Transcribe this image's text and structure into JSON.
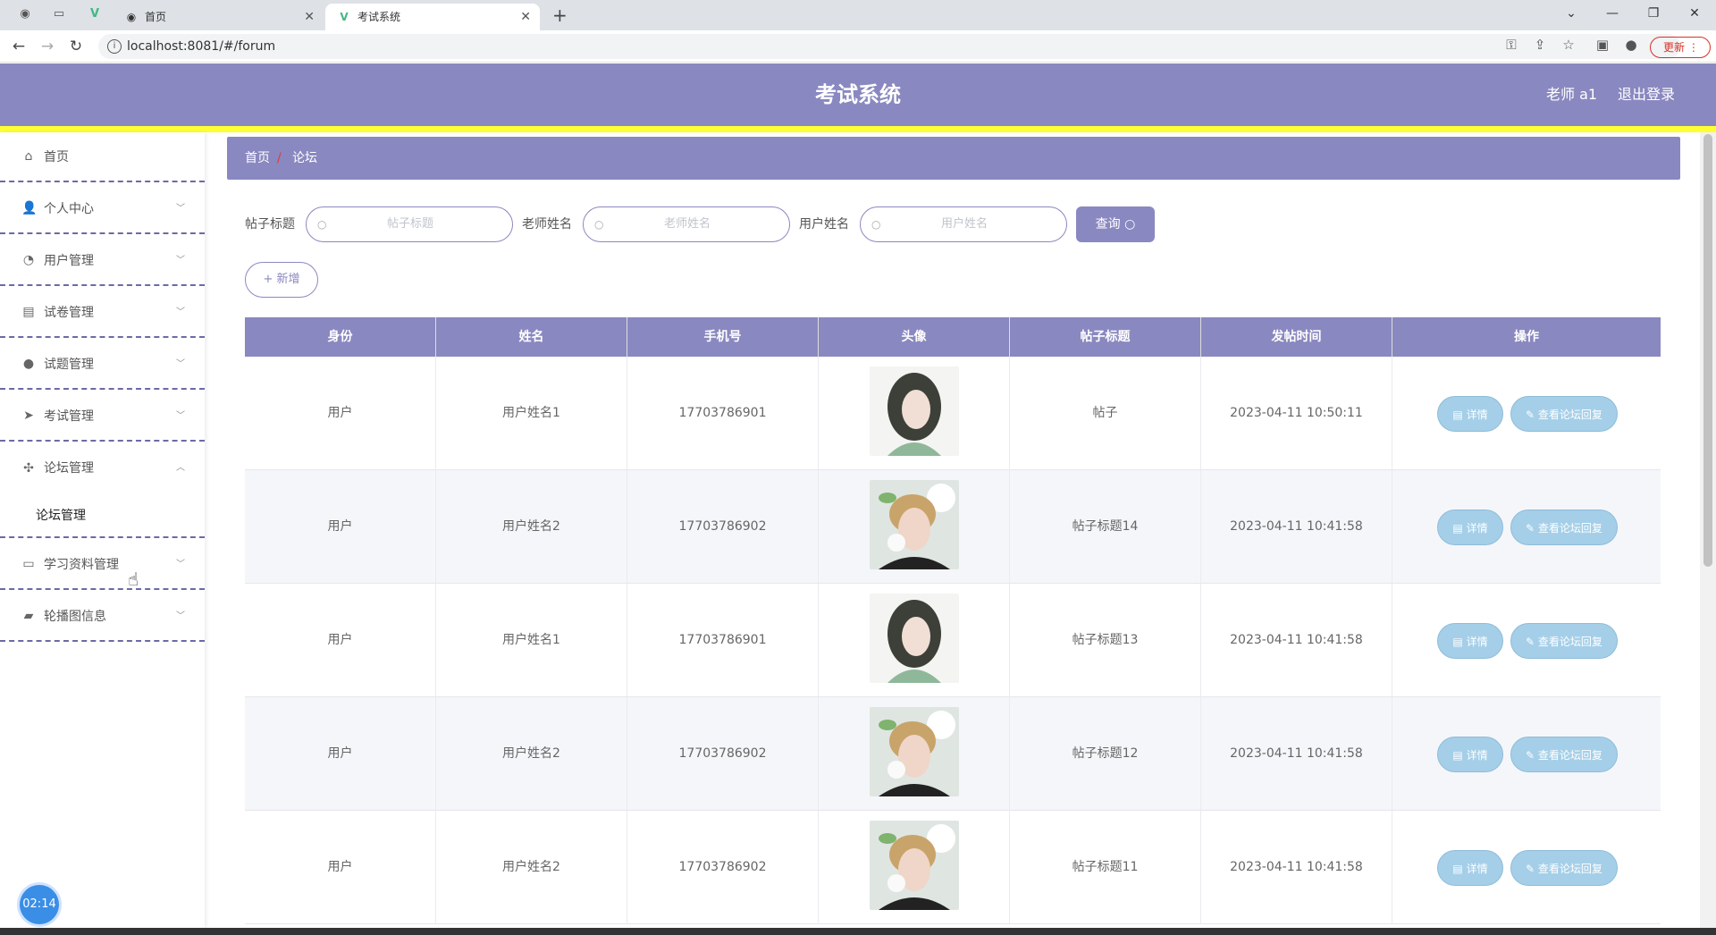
{
  "browser": {
    "tabs": [
      {
        "label": "",
        "icon": "globe-icon"
      },
      {
        "label": "",
        "icon": "page-icon"
      },
      {
        "label": "",
        "icon": "vue-icon"
      },
      {
        "label": "首页",
        "icon": "globe-icon"
      },
      {
        "label": "考试系统",
        "icon": "vue-icon"
      }
    ],
    "url": "localhost:8081/#/forum",
    "update_label": "更新"
  },
  "header": {
    "title": "考试系统",
    "user": "老师 a1",
    "logout": "退出登录"
  },
  "sidebar": {
    "items": [
      {
        "label": "首页",
        "icon": "home-icon",
        "chevron": ""
      },
      {
        "label": "个人中心",
        "icon": "user-icon",
        "chevron": "﹀"
      },
      {
        "label": "用户管理",
        "icon": "gauge-icon",
        "chevron": "﹀"
      },
      {
        "label": "试卷管理",
        "icon": "card-icon",
        "chevron": "﹀"
      },
      {
        "label": "试题管理",
        "icon": "bulb-icon",
        "chevron": "﹀"
      },
      {
        "label": "考试管理",
        "icon": "send-icon",
        "chevron": "﹀"
      },
      {
        "label": "论坛管理",
        "icon": "compass-icon",
        "chevron": "︿"
      },
      {
        "label": "学习资料管理",
        "icon": "chat-icon",
        "chevron": "﹀"
      },
      {
        "label": "轮播图信息",
        "icon": "briefcase-icon",
        "chevron": "﹀"
      }
    ],
    "submenu_label": "论坛管理",
    "timer": "02:14"
  },
  "breadcrumb": {
    "home": "首页",
    "separator": "/",
    "current": "论坛"
  },
  "search": {
    "title_label": "帖子标题",
    "title_placeholder": "帖子标题",
    "teacher_label": "老师姓名",
    "teacher_placeholder": "老师姓名",
    "user_label": "用户姓名",
    "user_placeholder": "用户姓名",
    "query_label": "查询"
  },
  "add_label": "新增",
  "table": {
    "headers": [
      "身份",
      "姓名",
      "手机号",
      "头像",
      "帖子标题",
      "发帖时间",
      "操作"
    ],
    "detail_label": "详情",
    "reply_label": "查看论坛回复",
    "rows": [
      {
        "role": "用户",
        "name": "用户姓名1",
        "phone": "17703786901",
        "avatar": "avatar-a",
        "title": "帖子",
        "time": "2023-04-11 10:50:11"
      },
      {
        "role": "用户",
        "name": "用户姓名2",
        "phone": "17703786902",
        "avatar": "avatar-b",
        "title": "帖子标题14",
        "time": "2023-04-11 10:41:58"
      },
      {
        "role": "用户",
        "name": "用户姓名1",
        "phone": "17703786901",
        "avatar": "avatar-a",
        "title": "帖子标题13",
        "time": "2023-04-11 10:41:58"
      },
      {
        "role": "用户",
        "name": "用户姓名2",
        "phone": "17703786902",
        "avatar": "avatar-b",
        "title": "帖子标题12",
        "time": "2023-04-11 10:41:58"
      },
      {
        "role": "用户",
        "name": "用户姓名2",
        "phone": "17703786902",
        "avatar": "avatar-b",
        "title": "帖子标题11",
        "time": "2023-04-11 10:41:58"
      }
    ]
  },
  "colors": {
    "primary": "#8a88c0",
    "accent_line": "#ffff33",
    "action": "#a5cfe8"
  }
}
